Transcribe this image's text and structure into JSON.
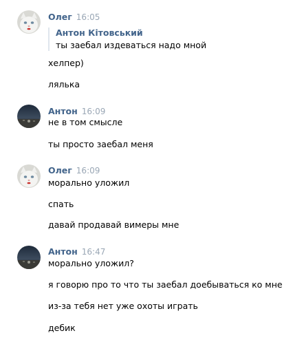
{
  "messages": [
    {
      "author": "Олег",
      "time": "16:05",
      "avatar_icon": "white-cat-avatar-icon",
      "quote": {
        "author": "Антон Кітовський",
        "text": "ты заебал издеваться надо мной"
      },
      "lines": [
        "хелпер)",
        "лялька"
      ]
    },
    {
      "author": "Антон",
      "time": "16:09",
      "avatar_icon": "dark-landscape-avatar-icon",
      "lines": [
        "не в том смысле",
        "ты просто заебал меня"
      ]
    },
    {
      "author": "Олег",
      "time": "16:09",
      "avatar_icon": "white-cat-avatar-icon",
      "lines": [
        "морально уложил",
        "спать",
        "давай продавай вимеры мне"
      ]
    },
    {
      "author": "Антон",
      "time": "16:47",
      "avatar_icon": "dark-landscape-avatar-icon",
      "lines": [
        "морально уложил?",
        "я говорю про то что ты заебал доебываться ко мне",
        "из-за тебя нет уже охоты играть",
        "дебик"
      ]
    }
  ],
  "colors": {
    "author": "#42648b",
    "time": "#9aa7b5",
    "text": "#000000",
    "quote_bar": "#dfe6ed"
  }
}
